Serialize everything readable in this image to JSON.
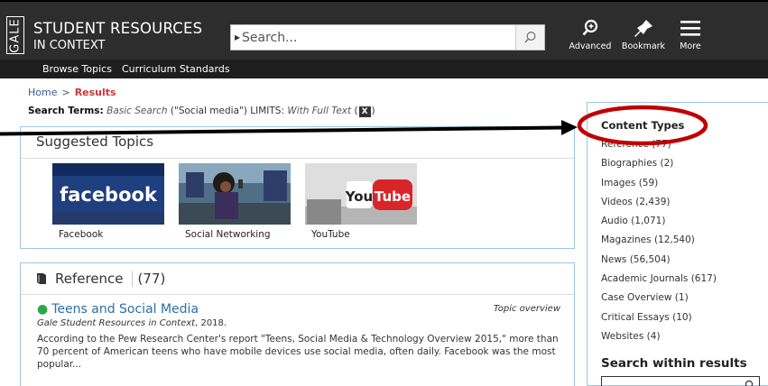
{
  "header": {
    "brand": "GALE",
    "product_line1": "STUDENT RESOURCES",
    "product_line2": "IN CONTEXT",
    "search_placeholder": "Search...",
    "tools": [
      {
        "icon": "advanced-search-icon",
        "label": "Advanced"
      },
      {
        "icon": "bookmark-icon",
        "label": "Bookmark"
      },
      {
        "icon": "menu-icon",
        "label": "More"
      }
    ]
  },
  "subnav": {
    "items": [
      "Browse Topics",
      "Curriculum Standards"
    ]
  },
  "breadcrumb": {
    "home": "Home",
    "separator": ">",
    "current": "Results"
  },
  "search_terms": {
    "label": "Search Terms:",
    "type": "Basic Search",
    "query": "(\"Social media\")",
    "limits_label": "LIMITS:",
    "limit": "With Full Text",
    "remove": "X"
  },
  "suggested": {
    "title": "Suggested Topics",
    "topics": [
      {
        "caption": "Facebook",
        "logo_text": "facebook"
      },
      {
        "caption": "Social Networking"
      },
      {
        "caption": "YouTube",
        "logo_you": "You",
        "logo_tube": "Tube"
      }
    ]
  },
  "reference": {
    "title": "Reference",
    "count": "(77)",
    "article": {
      "title": "Teens and Social Media",
      "kind": "Topic overview",
      "source": "Gale Student Resources in Context",
      "year": ", 2018.",
      "snippet": "According to the Pew Research Center's report \"Teens, Social Media & Technology Overview 2015,\" more than 70 percent of American teens who have mobile devices use social media, often daily. Facebook was the most popular..."
    }
  },
  "sidebar": {
    "title": "Content Types",
    "items": [
      "Reference (77)",
      "Biographies (2)",
      "Images (59)",
      "Videos (2,439)",
      "Audio (1,071)",
      "Magazines (12,540)",
      "News (56,504)",
      "Academic Journals (617)",
      "Case Overview (1)",
      "Critical Essays (10)",
      "Websites (4)"
    ],
    "search_within": "Search within results"
  },
  "colors": {
    "header_bg": "#2d2d2d",
    "accent_blue": "#2c6ea3",
    "highlight_red": "#c00000",
    "crumb_red": "#c8373a"
  }
}
